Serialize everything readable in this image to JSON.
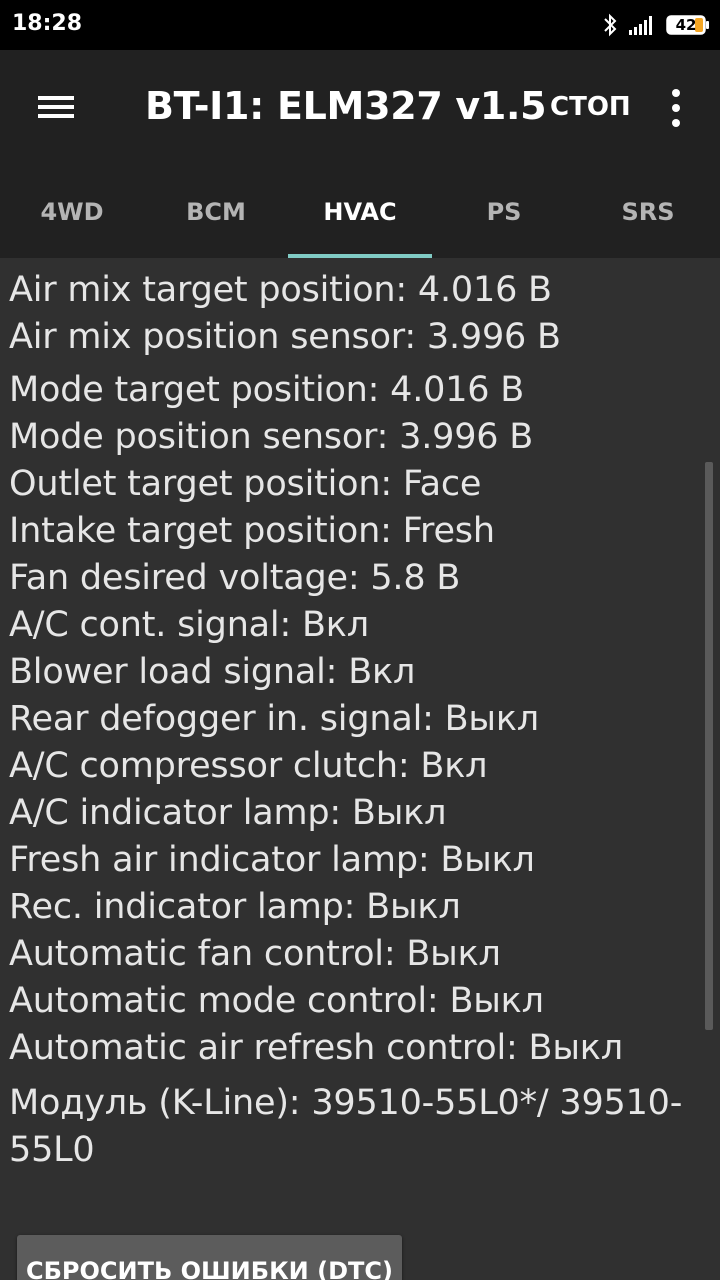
{
  "status_bar": {
    "time": "18:28",
    "battery": "42",
    "icons": [
      "bluetooth-icon",
      "signal-icon",
      "battery-icon"
    ]
  },
  "app_bar": {
    "title": "BT-I1: ELM327 v1.5",
    "stop_label": "СТОП",
    "tabs": [
      {
        "label": "4WD",
        "active": false
      },
      {
        "label": "BCM",
        "active": false
      },
      {
        "label": "HVAC",
        "active": true
      },
      {
        "label": "PS",
        "active": false
      },
      {
        "label": "SRS",
        "active": false
      }
    ],
    "accent_color": "#80cbc4"
  },
  "params": [
    "Air mix target position: 4.016 В",
    "Air mix position sensor: 3.996 В",
    "Mode target position: 4.016 В",
    "Mode position sensor: 3.996 В",
    "Outlet target position: Face",
    "Intake target position: Fresh",
    "Fan desired voltage: 5.8 В",
    "A/C cont. signal: Вкл",
    "Blower load signal: Вкл",
    "Rear defogger in. signal: Выкл",
    "A/C compressor clutch: Вкл",
    "A/C indicator lamp: Выкл",
    "Fresh air indicator lamp: Выкл",
    "Rec. indicator lamp: Выкл",
    "Automatic fan control: Выкл",
    "Automatic mode control: Выкл",
    "Automatic air refresh control: Выкл"
  ],
  "module_line": "Модуль (K-Line): 39510-55L0*/ 39510-55L0",
  "reset_button_label": "СБРОСИТЬ ОШИБКИ (DTC)"
}
